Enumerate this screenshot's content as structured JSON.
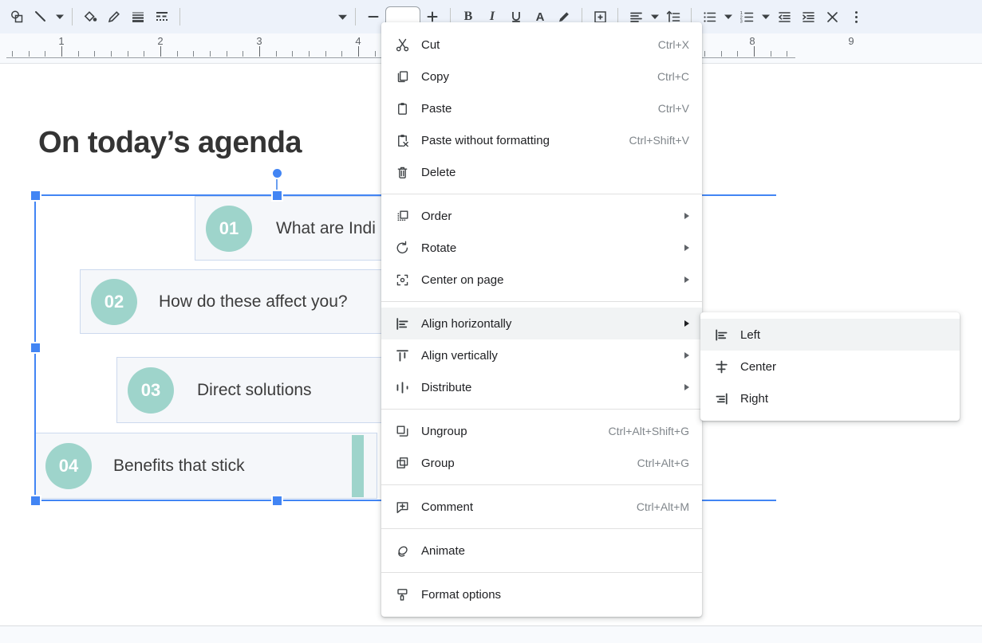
{
  "toolbar": {
    "items": [
      {
        "name": "select-shape-icon",
        "label": "Select"
      },
      {
        "name": "line-icon",
        "label": "Line"
      },
      {
        "name": "line-dropdown-caret-icon",
        "label": "Line options"
      },
      {
        "name": "fill-color-icon",
        "label": "Fill color"
      },
      {
        "name": "border-color-icon",
        "label": "Border color"
      },
      {
        "name": "border-weight-icon",
        "label": "Border weight"
      },
      {
        "name": "border-dash-icon",
        "label": "Border dash"
      },
      {
        "name": "font-family-caret-icon",
        "label": "Font"
      },
      {
        "name": "decrease-font-size-icon",
        "label": "Decrease font size"
      },
      {
        "name": "font-size-field",
        "label": "Font size"
      },
      {
        "name": "increase-font-size-icon",
        "label": "Increase font size"
      },
      {
        "name": "bold-icon",
        "label": "B"
      },
      {
        "name": "italic-icon",
        "label": "I"
      },
      {
        "name": "underline-icon",
        "label": "U"
      },
      {
        "name": "text-color-icon",
        "label": "A"
      },
      {
        "name": "highlight-color-icon",
        "label": "Highlight color"
      },
      {
        "name": "insert-link-icon",
        "label": "Insert link"
      },
      {
        "name": "align-icon",
        "label": "Align"
      },
      {
        "name": "align-caret-icon",
        "label": "Align options"
      },
      {
        "name": "line-spacing-icon",
        "label": "Line spacing"
      },
      {
        "name": "bulleted-list-icon",
        "label": "Bulleted list"
      },
      {
        "name": "bulleted-list-caret-icon",
        "label": "Bulleted list options"
      },
      {
        "name": "numbered-list-icon",
        "label": "Numbered list"
      },
      {
        "name": "numbered-list-caret-icon",
        "label": "Numbered list options"
      },
      {
        "name": "decrease-indent-icon",
        "label": "Decrease indent"
      },
      {
        "name": "increase-indent-icon",
        "label": "Increase indent"
      },
      {
        "name": "clear-formatting-icon",
        "label": "Clear formatting"
      },
      {
        "name": "more-options-icon",
        "label": "More"
      }
    ],
    "font_size_value": ""
  },
  "ruler": {
    "numbers": [
      "1",
      "2",
      "3",
      "4",
      "8",
      "9"
    ],
    "positions": [
      77,
      201,
      325,
      449,
      943,
      1067
    ]
  },
  "slide": {
    "title": "On today’s agenda",
    "items": [
      {
        "number": "01",
        "label": "What are Indi"
      },
      {
        "number": "02",
        "label": "How do these affect you?"
      },
      {
        "number": "03",
        "label": "Direct solutions"
      },
      {
        "number": "04",
        "label": "Benefits that stick"
      }
    ],
    "accent_color": "#9ed4cb",
    "item_bg": "#f5f7fa",
    "item_border": "#ccd9ee",
    "title_color": "#343434",
    "selection_color": "#4285f4"
  },
  "context_menu": {
    "groups": [
      {
        "items": [
          {
            "icon": "cut-icon",
            "label": "Cut",
            "accel": "Ctrl+X",
            "submenu": false,
            "highlighted": false
          },
          {
            "icon": "copy-icon",
            "label": "Copy",
            "accel": "Ctrl+C",
            "submenu": false,
            "highlighted": false
          },
          {
            "icon": "paste-icon",
            "label": "Paste",
            "accel": "Ctrl+V",
            "submenu": false,
            "highlighted": false
          },
          {
            "icon": "paste-without-formatting-icon",
            "label": "Paste without formatting",
            "accel": "Ctrl+Shift+V",
            "submenu": false,
            "highlighted": false
          },
          {
            "icon": "delete-icon",
            "label": "Delete",
            "accel": "",
            "submenu": false,
            "highlighted": false
          }
        ]
      },
      {
        "items": [
          {
            "icon": "order-icon",
            "label": "Order",
            "accel": "",
            "submenu": true,
            "highlighted": false
          },
          {
            "icon": "rotate-icon",
            "label": "Rotate",
            "accel": "",
            "submenu": true,
            "highlighted": false
          },
          {
            "icon": "center-on-page-icon",
            "label": "Center on page",
            "accel": "",
            "submenu": true,
            "highlighted": false
          }
        ]
      },
      {
        "items": [
          {
            "icon": "align-horizontally-icon",
            "label": "Align horizontally",
            "accel": "",
            "submenu": true,
            "highlighted": true
          },
          {
            "icon": "align-vertically-icon",
            "label": "Align vertically",
            "accel": "",
            "submenu": true,
            "highlighted": false
          },
          {
            "icon": "distribute-icon",
            "label": "Distribute",
            "accel": "",
            "submenu": true,
            "highlighted": false
          }
        ]
      },
      {
        "items": [
          {
            "icon": "ungroup-icon",
            "label": "Ungroup",
            "accel": "Ctrl+Alt+Shift+G",
            "submenu": false,
            "highlighted": false
          },
          {
            "icon": "group-icon",
            "label": "Group",
            "accel": "Ctrl+Alt+G",
            "submenu": false,
            "highlighted": false
          }
        ]
      },
      {
        "items": [
          {
            "icon": "comment-icon",
            "label": "Comment",
            "accel": "Ctrl+Alt+M",
            "submenu": false,
            "highlighted": false
          }
        ]
      },
      {
        "items": [
          {
            "icon": "animate-icon",
            "label": "Animate",
            "accel": "",
            "submenu": false,
            "highlighted": false
          }
        ]
      },
      {
        "items": [
          {
            "icon": "format-options-icon",
            "label": "Format options",
            "accel": "",
            "submenu": false,
            "highlighted": false
          }
        ]
      }
    ]
  },
  "submenu": {
    "items": [
      {
        "icon": "align-left-icon",
        "label": "Left",
        "highlighted": true
      },
      {
        "icon": "align-center-icon",
        "label": "Center",
        "highlighted": false
      },
      {
        "icon": "align-right-icon",
        "label": "Right",
        "highlighted": false
      }
    ]
  }
}
